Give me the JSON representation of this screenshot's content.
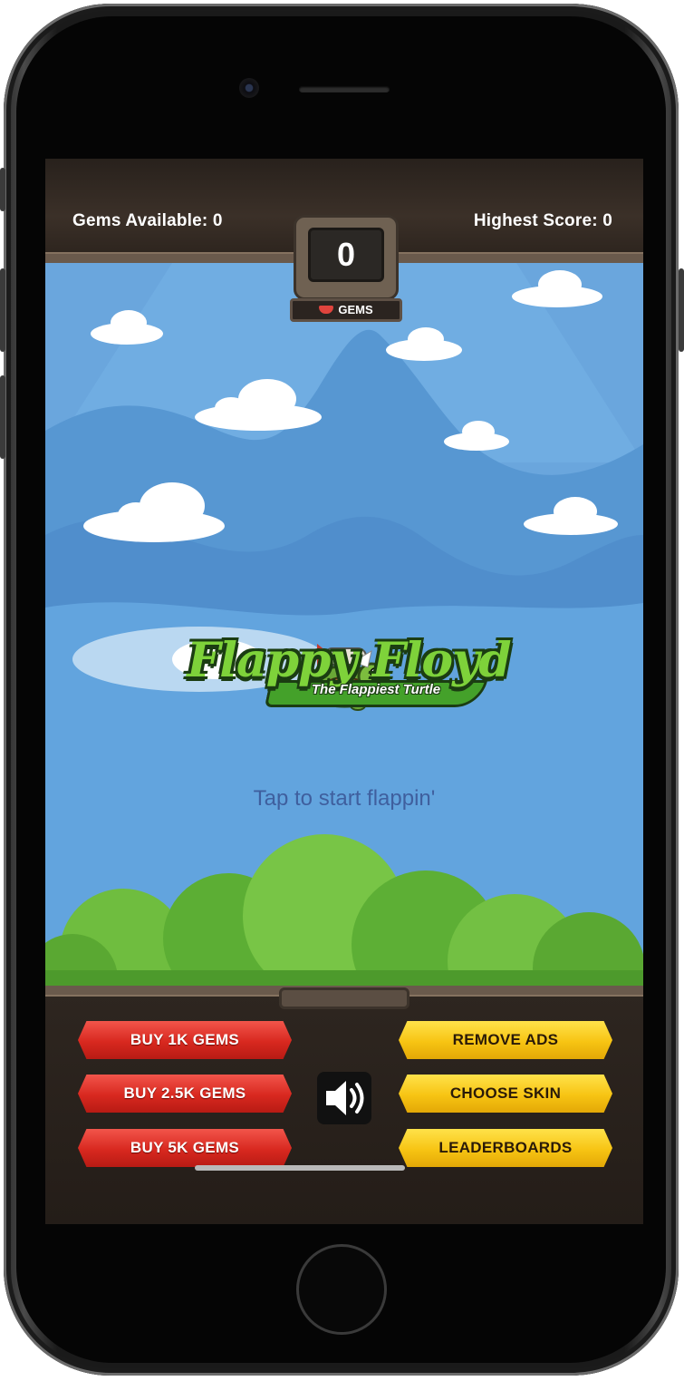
{
  "header": {
    "gems_available": "Gems Available: 0",
    "highest_score": "Highest Score: 0"
  },
  "scoreboard": {
    "score": "0",
    "label": "GEMS"
  },
  "logo": {
    "title": "Flappy Floyd",
    "subtitle": "The Flappiest Turtle"
  },
  "prompt": "Tap to start flappin'",
  "buttons": {
    "buy_1k": "BUY 1K GEMS",
    "buy_2_5k": "BUY 2.5K GEMS",
    "buy_5k": "BUY 5K GEMS",
    "remove_ads": "REMOVE ADS",
    "choose_skin": "CHOOSE SKIN",
    "leaderboards": "LEADERBOARDS"
  },
  "icons": {
    "sound": "speaker-icon",
    "gem": "gem-icon"
  },
  "colors": {
    "sky": "#6aa6dd",
    "red_button": "#d8281f",
    "yellow_button": "#f7c413",
    "frame": "#2e2620"
  }
}
